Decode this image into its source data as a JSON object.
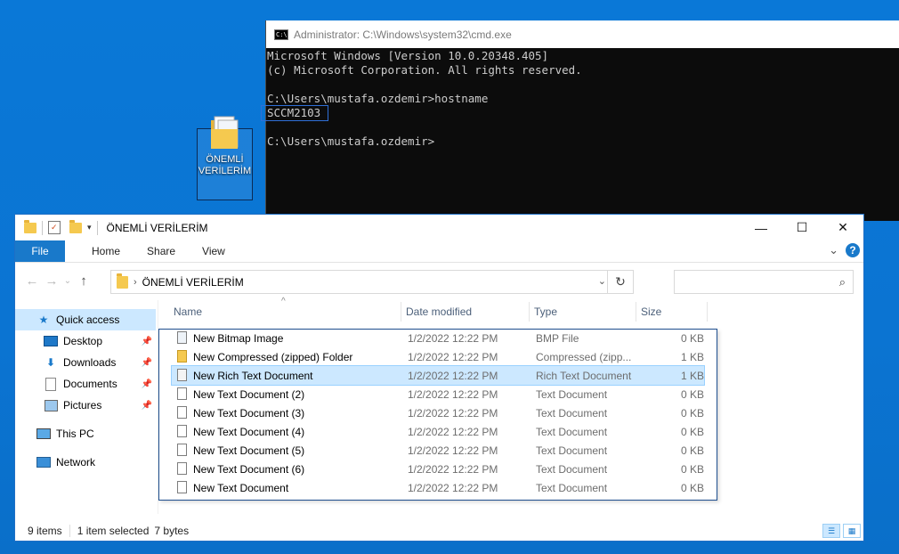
{
  "desktop": {
    "icon_label": "ÖNEMLİ VERİLERİM"
  },
  "cmd": {
    "title": "Administrator: C:\\Windows\\system32\\cmd.exe",
    "icon_text": "C:\\",
    "line1": "Microsoft Windows [Version 10.0.20348.405]",
    "line2": "(c) Microsoft Corporation. All rights reserved.",
    "line3": "C:\\Users\\mustafa.ozdemir>hostname",
    "line4": "SCCM2103",
    "line5": "C:\\Users\\mustafa.ozdemir>"
  },
  "explorer": {
    "title": "ÖNEMLİ VERİLERİM",
    "window_controls": {
      "minimize": "—",
      "maximize": "☐",
      "close": "✕"
    },
    "ribbon": {
      "file": "File",
      "home": "Home",
      "share": "Share",
      "view": "View",
      "expand": "⌄",
      "help": "?"
    },
    "address": {
      "path": "ÖNEMLİ VERİLERİM",
      "chevron": "›",
      "dropdown": "⌄",
      "refresh": "↻"
    },
    "search": {
      "placeholder": ""
    },
    "nav_arrows": {
      "back": "←",
      "forward": "→",
      "recent": "⌄",
      "up": "↑"
    },
    "nav_pane": [
      {
        "label": "Quick access",
        "icon": "star-icon"
      },
      {
        "label": "Desktop",
        "icon": "desktop-icon",
        "pinned": true
      },
      {
        "label": "Downloads",
        "icon": "download-icon",
        "pinned": true
      },
      {
        "label": "Documents",
        "icon": "documents-icon",
        "pinned": true
      },
      {
        "label": "Pictures",
        "icon": "pictures-icon",
        "pinned": true
      },
      {
        "label": "This PC",
        "icon": "pc-icon"
      },
      {
        "label": "Network",
        "icon": "network-icon"
      }
    ],
    "columns": {
      "name": "Name",
      "date": "Date modified",
      "type": "Type",
      "size": "Size"
    },
    "files": [
      {
        "name": "New Bitmap Image",
        "date": "1/2/2022 12:22 PM",
        "type": "BMP File",
        "size": "0 KB",
        "icon": "bmp"
      },
      {
        "name": "New Compressed (zipped) Folder",
        "date": "1/2/2022 12:22 PM",
        "type": "Compressed (zipp...",
        "size": "1 KB",
        "icon": "zip"
      },
      {
        "name": "New Rich Text Document",
        "date": "1/2/2022 12:22 PM",
        "type": "Rich Text Document",
        "size": "1 KB",
        "icon": "rtf",
        "selected": true
      },
      {
        "name": "New Text Document (2)",
        "date": "1/2/2022 12:22 PM",
        "type": "Text Document",
        "size": "0 KB",
        "icon": "txt"
      },
      {
        "name": "New Text Document (3)",
        "date": "1/2/2022 12:22 PM",
        "type": "Text Document",
        "size": "0 KB",
        "icon": "txt"
      },
      {
        "name": "New Text Document (4)",
        "date": "1/2/2022 12:22 PM",
        "type": "Text Document",
        "size": "0 KB",
        "icon": "txt"
      },
      {
        "name": "New Text Document (5)",
        "date": "1/2/2022 12:22 PM",
        "type": "Text Document",
        "size": "0 KB",
        "icon": "txt"
      },
      {
        "name": "New Text Document (6)",
        "date": "1/2/2022 12:22 PM",
        "type": "Text Document",
        "size": "0 KB",
        "icon": "txt"
      },
      {
        "name": "New Text Document",
        "date": "1/2/2022 12:22 PM",
        "type": "Text Document",
        "size": "0 KB",
        "icon": "txt"
      }
    ],
    "status": {
      "count": "9 items",
      "selection": "1 item selected",
      "bytes": "7 bytes"
    },
    "colors": {
      "accent": "#1979ca",
      "selection": "#cce8ff",
      "desktop": "#0a78d7"
    }
  }
}
